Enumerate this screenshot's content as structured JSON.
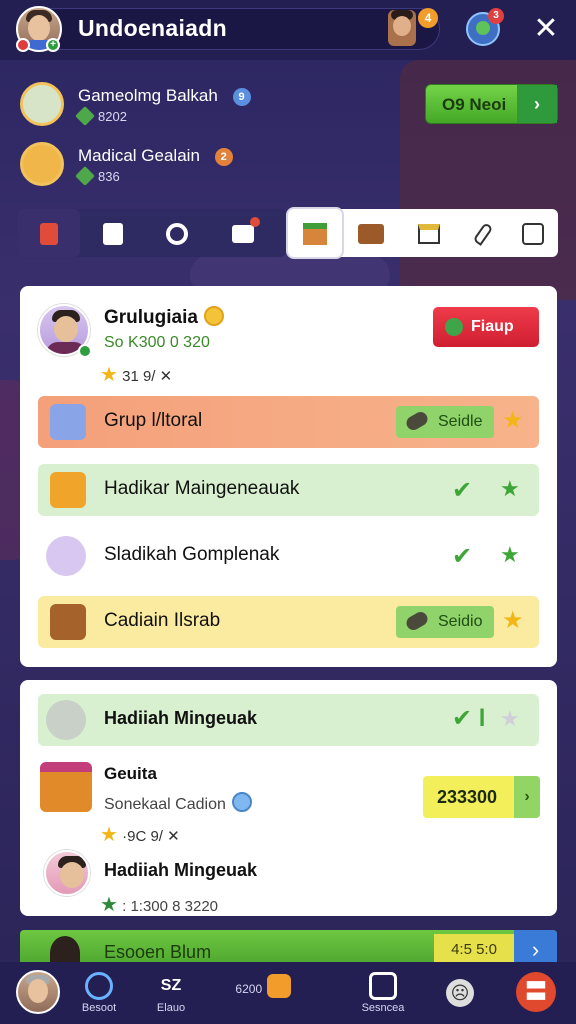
{
  "header": {
    "title": "Undoenaiadn",
    "notif_count_a": "4",
    "notif_count_b": "3",
    "close_label": "✕"
  },
  "summary": [
    {
      "title": "Gameolmg Balkah",
      "sub": "8202",
      "badge": "9"
    },
    {
      "title": "Madical Gealain",
      "sub": "836",
      "badge": "2"
    }
  ],
  "next_button": {
    "label": "O9 Neoi",
    "arrow": "›"
  },
  "tabs_left": [
    "tab-a",
    "tab-b",
    "tab-c",
    "tab-d"
  ],
  "tabs_right": [
    "gift",
    "chest",
    "calendar",
    "feather",
    "puzzle"
  ],
  "card1": {
    "player_name": "Grulugiaia",
    "player_score": "So K300 0 320",
    "player_stats": "31   9/ ✕",
    "action_label": "Fiaup",
    "rows": [
      {
        "label": "Grup l/ltoral",
        "pill": "Seidle"
      },
      {
        "label": "Hadikar Maingeneauak"
      },
      {
        "label": "Sladikah Gomplenak"
      },
      {
        "label": "Cadiain Ilsrab",
        "pill": "Seidio"
      }
    ]
  },
  "card2": {
    "row_label": "Hadiiah Mingeuak",
    "row_check": "✔ l",
    "item_title": "Geuita",
    "item_sub": "Sonekaal Cadion",
    "item_stats": "·9C   9/ ✕",
    "price": "233300",
    "price_arrow": "›",
    "item2_title": "Hadiiah Mingeuak",
    "item2_sub": ": 1:300 8 3220"
  },
  "bottom_strip": {
    "label": "Esooen Blum",
    "value": "4:5 5:0",
    "arrow": "›"
  },
  "nav": {
    "item1": "Besoot",
    "item2": "Elauo",
    "item2_icon": "SZ",
    "item3_label": "6200",
    "item4": "Sesncea",
    "menu_symbol": "〓"
  },
  "colors": {
    "accent_green": "#4aa22d",
    "accent_red": "#d62a39",
    "bg": "#2a2560"
  }
}
